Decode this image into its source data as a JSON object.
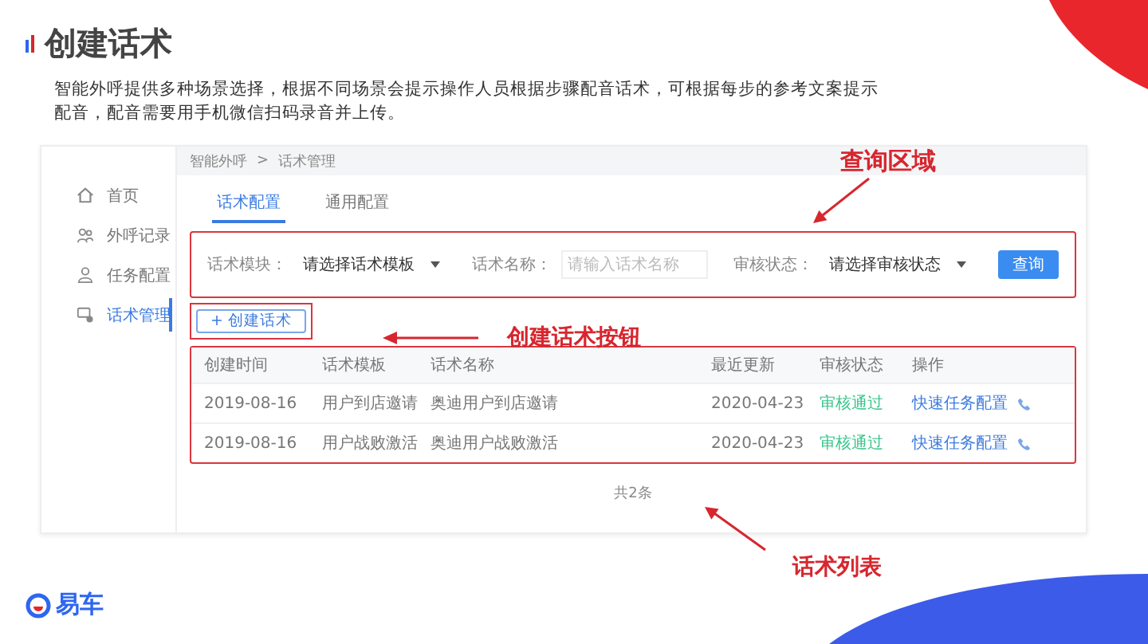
{
  "slide": {
    "title": "创建话术",
    "description": "智能外呼提供多种场景选择，根据不同场景会提示操作人员根据步骤配音话术，可根据每步的参考文案提示配音，配音需要用手机微信扫码录音并上传。"
  },
  "sidebar": {
    "items": [
      {
        "label": "首页",
        "selected": false
      },
      {
        "label": "外呼记录",
        "selected": false
      },
      {
        "label": "任务配置",
        "selected": false
      },
      {
        "label": "话术管理",
        "selected": true
      }
    ]
  },
  "breadcrumb": {
    "items": [
      "智能外呼",
      "话术管理"
    ],
    "separator": ">"
  },
  "tabs": [
    {
      "label": "话术配置",
      "selected": true
    },
    {
      "label": "通用配置",
      "selected": false
    }
  ],
  "query": {
    "fields": [
      {
        "kind": "select",
        "label": "话术模块：",
        "value": "请选择话术模板"
      },
      {
        "kind": "input",
        "label": "话术名称：",
        "placeholder": "请输入话术名称"
      },
      {
        "kind": "select",
        "label": "审核状态：",
        "value": "请选择审核状态"
      }
    ],
    "button": "查询"
  },
  "create_button": "+ 创建话术",
  "table": {
    "columns": [
      "创建时间",
      "话术模板",
      "话术名称",
      "最近更新",
      "审核状态",
      "操作"
    ],
    "rows": [
      {
        "cells": [
          "2019-08-16",
          "用户到店邀请",
          "奥迪用户到店邀请",
          "2020-04-23"
        ],
        "status": "审核通过",
        "action": "快速任务配置"
      },
      {
        "cells": [
          "2019-08-16",
          "用户战败激活",
          "奥迪用户战败激活",
          "2020-04-23"
        ],
        "status": "审核通过",
        "action": "快速任务配置"
      }
    ]
  },
  "pagination": "共2条",
  "annotations": [
    {
      "kind": "query",
      "label": "查询区域"
    },
    {
      "kind": "create",
      "label": "创建话术按钮"
    },
    {
      "kind": "list",
      "label": "话术列表"
    }
  ],
  "brand": {
    "name": "易车"
  }
}
